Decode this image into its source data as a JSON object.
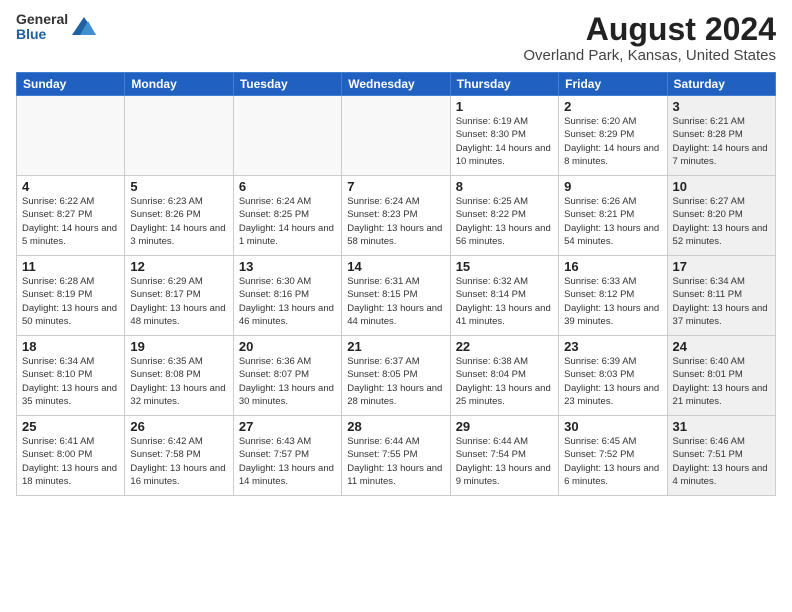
{
  "logo": {
    "general": "General",
    "blue": "Blue"
  },
  "title": "August 2024",
  "subtitle": "Overland Park, Kansas, United States",
  "days_header": [
    "Sunday",
    "Monday",
    "Tuesday",
    "Wednesday",
    "Thursday",
    "Friday",
    "Saturday"
  ],
  "weeks": [
    [
      {
        "day": "",
        "info": "",
        "shaded": true
      },
      {
        "day": "",
        "info": "",
        "shaded": true
      },
      {
        "day": "",
        "info": "",
        "shaded": true
      },
      {
        "day": "",
        "info": "",
        "shaded": true
      },
      {
        "day": "1",
        "info": "Sunrise: 6:19 AM\nSunset: 8:30 PM\nDaylight: 14 hours and 10 minutes."
      },
      {
        "day": "2",
        "info": "Sunrise: 6:20 AM\nSunset: 8:29 PM\nDaylight: 14 hours and 8 minutes."
      },
      {
        "day": "3",
        "info": "Sunrise: 6:21 AM\nSunset: 8:28 PM\nDaylight: 14 hours and 7 minutes.",
        "shaded": true
      }
    ],
    [
      {
        "day": "4",
        "info": "Sunrise: 6:22 AM\nSunset: 8:27 PM\nDaylight: 14 hours and 5 minutes."
      },
      {
        "day": "5",
        "info": "Sunrise: 6:23 AM\nSunset: 8:26 PM\nDaylight: 14 hours and 3 minutes."
      },
      {
        "day": "6",
        "info": "Sunrise: 6:24 AM\nSunset: 8:25 PM\nDaylight: 14 hours and 1 minute."
      },
      {
        "day": "7",
        "info": "Sunrise: 6:24 AM\nSunset: 8:23 PM\nDaylight: 13 hours and 58 minutes."
      },
      {
        "day": "8",
        "info": "Sunrise: 6:25 AM\nSunset: 8:22 PM\nDaylight: 13 hours and 56 minutes."
      },
      {
        "day": "9",
        "info": "Sunrise: 6:26 AM\nSunset: 8:21 PM\nDaylight: 13 hours and 54 minutes."
      },
      {
        "day": "10",
        "info": "Sunrise: 6:27 AM\nSunset: 8:20 PM\nDaylight: 13 hours and 52 minutes.",
        "shaded": true
      }
    ],
    [
      {
        "day": "11",
        "info": "Sunrise: 6:28 AM\nSunset: 8:19 PM\nDaylight: 13 hours and 50 minutes."
      },
      {
        "day": "12",
        "info": "Sunrise: 6:29 AM\nSunset: 8:17 PM\nDaylight: 13 hours and 48 minutes."
      },
      {
        "day": "13",
        "info": "Sunrise: 6:30 AM\nSunset: 8:16 PM\nDaylight: 13 hours and 46 minutes."
      },
      {
        "day": "14",
        "info": "Sunrise: 6:31 AM\nSunset: 8:15 PM\nDaylight: 13 hours and 44 minutes."
      },
      {
        "day": "15",
        "info": "Sunrise: 6:32 AM\nSunset: 8:14 PM\nDaylight: 13 hours and 41 minutes."
      },
      {
        "day": "16",
        "info": "Sunrise: 6:33 AM\nSunset: 8:12 PM\nDaylight: 13 hours and 39 minutes."
      },
      {
        "day": "17",
        "info": "Sunrise: 6:34 AM\nSunset: 8:11 PM\nDaylight: 13 hours and 37 minutes.",
        "shaded": true
      }
    ],
    [
      {
        "day": "18",
        "info": "Sunrise: 6:34 AM\nSunset: 8:10 PM\nDaylight: 13 hours and 35 minutes."
      },
      {
        "day": "19",
        "info": "Sunrise: 6:35 AM\nSunset: 8:08 PM\nDaylight: 13 hours and 32 minutes."
      },
      {
        "day": "20",
        "info": "Sunrise: 6:36 AM\nSunset: 8:07 PM\nDaylight: 13 hours and 30 minutes."
      },
      {
        "day": "21",
        "info": "Sunrise: 6:37 AM\nSunset: 8:05 PM\nDaylight: 13 hours and 28 minutes."
      },
      {
        "day": "22",
        "info": "Sunrise: 6:38 AM\nSunset: 8:04 PM\nDaylight: 13 hours and 25 minutes."
      },
      {
        "day": "23",
        "info": "Sunrise: 6:39 AM\nSunset: 8:03 PM\nDaylight: 13 hours and 23 minutes."
      },
      {
        "day": "24",
        "info": "Sunrise: 6:40 AM\nSunset: 8:01 PM\nDaylight: 13 hours and 21 minutes.",
        "shaded": true
      }
    ],
    [
      {
        "day": "25",
        "info": "Sunrise: 6:41 AM\nSunset: 8:00 PM\nDaylight: 13 hours and 18 minutes."
      },
      {
        "day": "26",
        "info": "Sunrise: 6:42 AM\nSunset: 7:58 PM\nDaylight: 13 hours and 16 minutes."
      },
      {
        "day": "27",
        "info": "Sunrise: 6:43 AM\nSunset: 7:57 PM\nDaylight: 13 hours and 14 minutes."
      },
      {
        "day": "28",
        "info": "Sunrise: 6:44 AM\nSunset: 7:55 PM\nDaylight: 13 hours and 11 minutes."
      },
      {
        "day": "29",
        "info": "Sunrise: 6:44 AM\nSunset: 7:54 PM\nDaylight: 13 hours and 9 minutes."
      },
      {
        "day": "30",
        "info": "Sunrise: 6:45 AM\nSunset: 7:52 PM\nDaylight: 13 hours and 6 minutes."
      },
      {
        "day": "31",
        "info": "Sunrise: 6:46 AM\nSunset: 7:51 PM\nDaylight: 13 hours and 4 minutes.",
        "shaded": true
      }
    ]
  ]
}
